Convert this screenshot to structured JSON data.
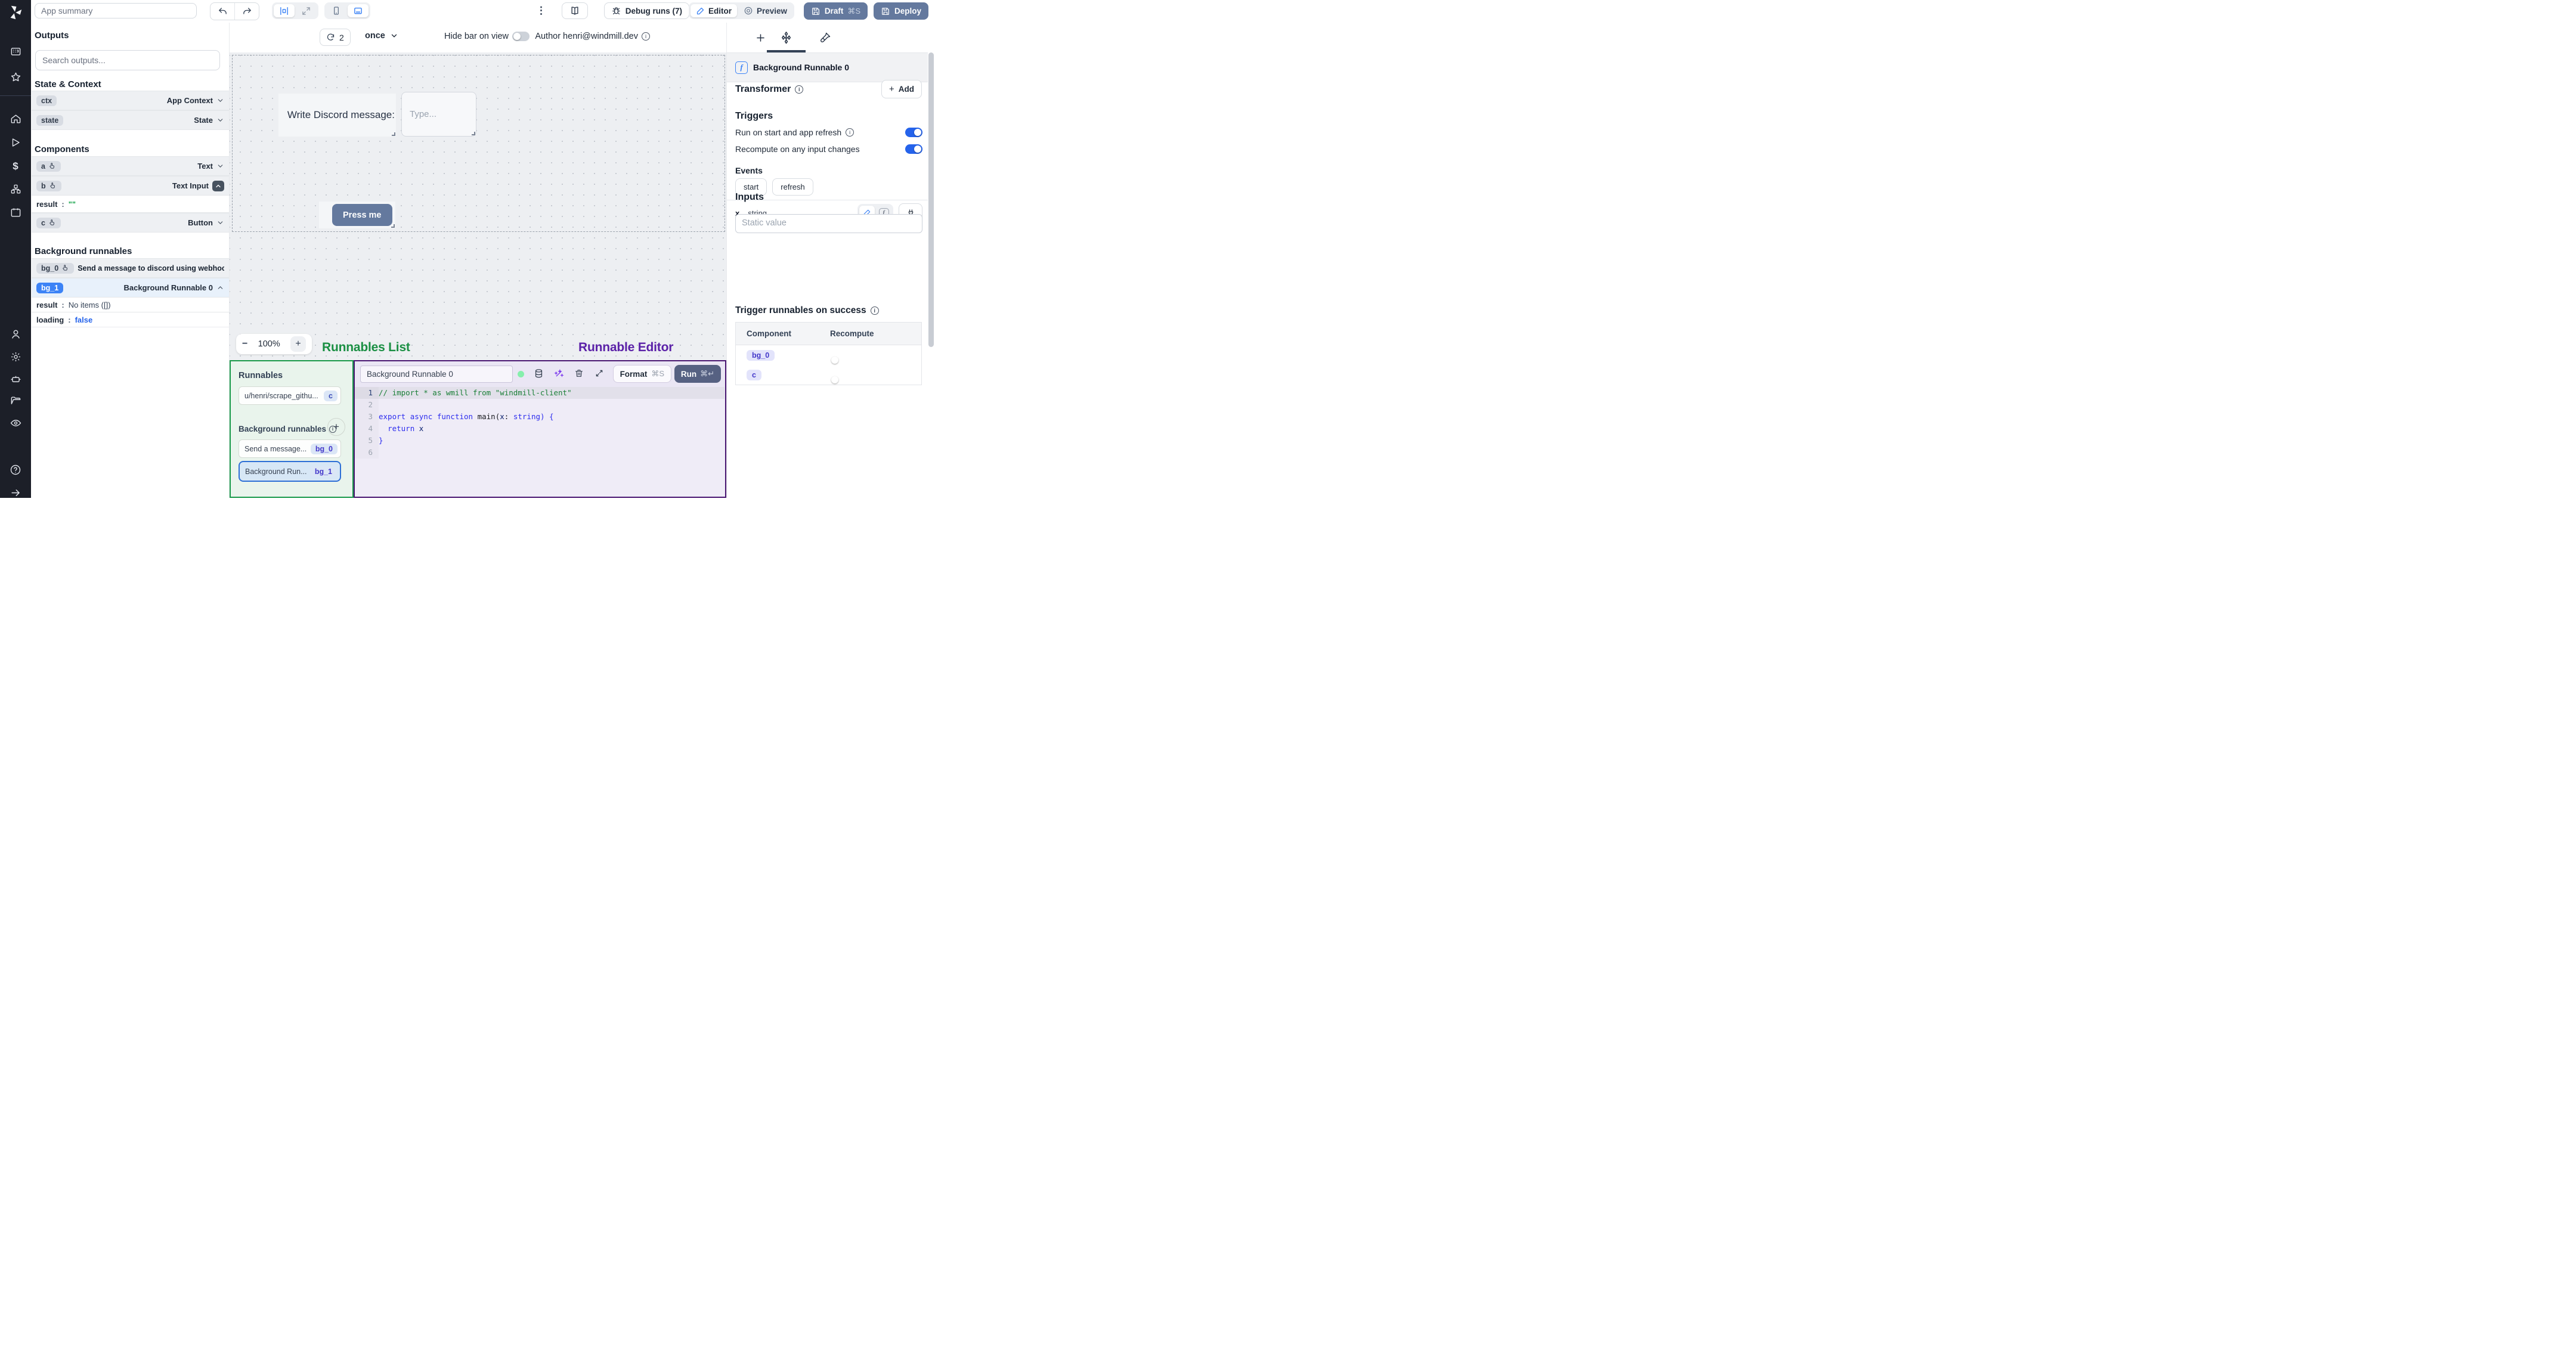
{
  "topbar": {
    "app_summary_placeholder": "App summary",
    "debug_runs_label": "Debug runs (7)",
    "editor_label": "Editor",
    "preview_label": "Preview",
    "draft_label": "Draft",
    "draft_shortcut": "⌘S",
    "deploy_label": "Deploy"
  },
  "canvas_toolbar": {
    "refresh_count": "2",
    "interval_label": "once",
    "hide_bar_label": "Hide bar on view",
    "hide_bar_on": false,
    "author_label": "Author henri@windmill.dev"
  },
  "canvas": {
    "text_component": "Write Discord message:",
    "input_placeholder": "Type...",
    "button_label": "Press me",
    "zoom_level": "100%",
    "zoom_minus": "−",
    "zoom_plus": "+"
  },
  "annotations": {
    "runnables_list": "Runnables List",
    "runnable_editor": "Runnable Editor"
  },
  "outputs_panel": {
    "title": "Outputs",
    "search_placeholder": "Search outputs...",
    "state_context_title": "State & Context",
    "ctx_id": "ctx",
    "ctx_type": "App Context",
    "state_id": "state",
    "state_type": "State",
    "components_title": "Components",
    "comp_a_id": "a",
    "comp_a_type": "Text",
    "comp_b_id": "b",
    "comp_b_type": "Text Input",
    "comp_b_result_key": "result",
    "comp_b_result_value": "\"\"",
    "comp_c_id": "c",
    "comp_c_type": "Button",
    "bg_title": "Background runnables",
    "bg0_id": "bg_0",
    "bg0_label": "Send a message to discord using webhoo",
    "bg1_id": "bg_1",
    "bg1_label": "Background Runnable 0",
    "bg1_result_key": "result",
    "bg1_result_value": "No items ([])",
    "bg1_loading_key": "loading",
    "bg1_loading_value": "false"
  },
  "runnables_panel": {
    "title": "Runnables",
    "script_item_label": "u/henri/scrape_githu...",
    "script_item_badge": "c",
    "bg_section_title": "Background runnables",
    "bg0_item_label": "Send a message...",
    "bg0_item_badge": "bg_0",
    "bg1_item_label": "Background Run...",
    "bg1_item_badge": "bg_1"
  },
  "editor": {
    "name": "Background Runnable 0",
    "format_label": "Format",
    "format_shortcut": "⌘S",
    "run_label": "Run",
    "run_shortcut": "⌘↵",
    "code": [
      {
        "n": "1",
        "current": true,
        "tokens": [
          {
            "t": "// import * as wmill from \"windmill-client\"",
            "c": "cmt"
          }
        ]
      },
      {
        "n": "2",
        "tokens": []
      },
      {
        "n": "3",
        "tokens": [
          {
            "t": "export",
            "c": "kw"
          },
          {
            "t": " ",
            "c": ""
          },
          {
            "t": "async",
            "c": "kw"
          },
          {
            "t": " ",
            "c": ""
          },
          {
            "t": "function",
            "c": "kw"
          },
          {
            "t": " ",
            "c": ""
          },
          {
            "t": "main",
            "c": "id"
          },
          {
            "t": "(",
            "c": "pl"
          },
          {
            "t": "x",
            "c": "vr"
          },
          {
            "t": ":",
            "c": "pl"
          },
          {
            "t": " ",
            "c": ""
          },
          {
            "t": "string",
            "c": "kw"
          },
          {
            "t": ") {",
            "c": "kw"
          }
        ]
      },
      {
        "n": "4",
        "tokens": [
          {
            "t": "  ",
            "c": ""
          },
          {
            "t": "return",
            "c": "kw"
          },
          {
            "t": " ",
            "c": ""
          },
          {
            "t": "x",
            "c": "vr"
          }
        ]
      },
      {
        "n": "5",
        "tokens": [
          {
            "t": "}",
            "c": "kw"
          }
        ]
      },
      {
        "n": "6",
        "tokens": []
      }
    ]
  },
  "settings_panel": {
    "header": "Background Runnable 0",
    "transformer_title": "Transformer",
    "add_label": "Add",
    "triggers_title": "Triggers",
    "trigger_run_on_start": "Run on start and app refresh",
    "trigger_run_on_start_on": true,
    "trigger_recompute": "Recompute on any input changes",
    "trigger_recompute_on": true,
    "events_title": "Events",
    "event_start": "start",
    "event_refresh": "refresh",
    "inputs_title": "Inputs",
    "input_name": "x",
    "input_type": "string",
    "static_placeholder": "Static value",
    "success_title": "Trigger runnables on success",
    "col_component": "Component",
    "col_recompute": "Recompute",
    "row1_badge": "bg_0",
    "row1_on": false,
    "row2_badge": "c",
    "row2_on": false
  },
  "colors": {
    "accent_blue": "#3c83f6",
    "toggle_on": "#2563eb",
    "slate_button": "#64799e",
    "run_button": "#566182",
    "annotation_green": "#1a9a4a",
    "annotation_purple": "#4a1772"
  }
}
